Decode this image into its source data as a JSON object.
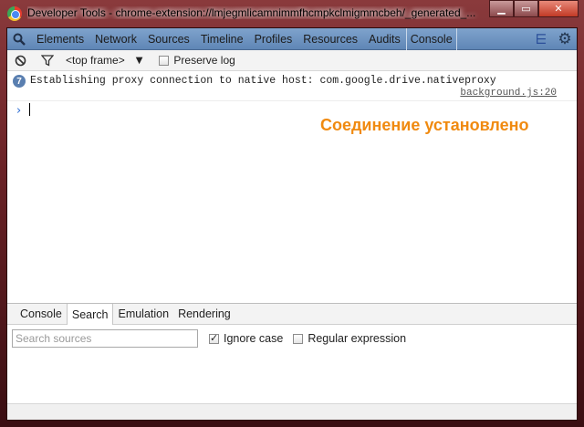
{
  "window": {
    "title": "Developer Tools - chrome-extension://lmjegmlicamnimmfhcmpkclmigmmcbeh/_generated_...",
    "controls": [
      "minimize",
      "maximize",
      "close"
    ]
  },
  "devtools": {
    "tabs": [
      {
        "label": "Elements"
      },
      {
        "label": "Network"
      },
      {
        "label": "Sources"
      },
      {
        "label": "Timeline"
      },
      {
        "label": "Profiles"
      },
      {
        "label": "Resources"
      },
      {
        "label": "Audits"
      },
      {
        "label": "Console",
        "active": true
      }
    ]
  },
  "console_toolbar": {
    "frame_select": "<top frame>",
    "preserve_log_label": "Preserve log",
    "preserve_log_checked": false
  },
  "console": {
    "messages": [
      {
        "count": "7",
        "text": "Establishing proxy connection to native host: com.google.drive.nativeproxy",
        "source": "background.js:20"
      }
    ],
    "prompt": "›"
  },
  "annotation": {
    "text": "Соединение установлено",
    "color": "#f08a10"
  },
  "drawer": {
    "tabs": [
      {
        "label": "Console"
      },
      {
        "label": "Search",
        "active": true
      },
      {
        "label": "Emulation"
      },
      {
        "label": "Rendering"
      }
    ],
    "search_placeholder": "Search sources",
    "ignore_case_label": "Ignore case",
    "ignore_case_checked": true,
    "regex_label": "Regular expression",
    "regex_checked": false
  },
  "colors": {
    "toolbar": "#6f95c2",
    "prompt": "#2a6bd3",
    "accent_annotation": "#f08a10"
  }
}
